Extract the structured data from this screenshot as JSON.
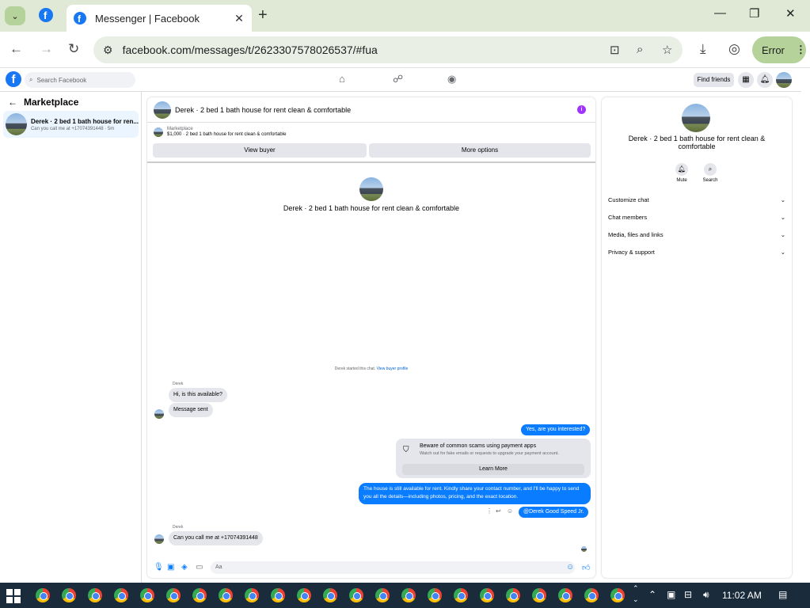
{
  "browser": {
    "tab_title": "Messenger | Facebook",
    "url": "facebook.com/messages/t/2623307578026537/#fua",
    "profile_button": "Error"
  },
  "fb": {
    "search_placeholder": "Search Facebook",
    "find_friends": "Find friends"
  },
  "sidebar": {
    "title": "Marketplace",
    "conversation": {
      "title": "Derek · 2 bed 1 bath house for ren...",
      "preview": "Can you call me at +17074391448 · 5m"
    }
  },
  "chat": {
    "header_title": "Derek · 2 bed 1 bath house for rent clean & comfortable",
    "marketplace_label": "Marketplace",
    "listing_line": "$1,000 · 2 bed 1 bath house for rent clean & comfortable",
    "view_buyer": "View buyer",
    "more_options": "More options",
    "center_name": "Derek · 2 bed 1 bath house for rent clean & comfortable",
    "started_text": "Derek started this chat.",
    "view_buyer_profile": "View buyer profile",
    "sender1": "Derek",
    "msg1": "Hi, is this available?",
    "msg2": "Message sent",
    "out1": "Yes, are you interested?",
    "warning_title": "Beware of common scams using payment apps",
    "warning_sub": "Watch out for fake emails or requests to upgrade your payment account.",
    "learn_more": "Learn More",
    "out2": "The house is still available for rent. Kindly share your contact number, and I'll be happy to send you all the details—including photos, pricing, and the exact location.",
    "mention": "@Derek Good Speed Jr.",
    "sender2": "Derek",
    "msg3": "Can you call me at +17074391448",
    "composer_placeholder": "Aa"
  },
  "details": {
    "name": "Derek · 2 bed 1 bath house for rent clean & comfortable",
    "mute": "Mute",
    "search": "Search",
    "rows": [
      "Customize chat",
      "Chat members",
      "Media, files and links",
      "Privacy & support"
    ]
  },
  "taskbar": {
    "time": "11:02 AM"
  },
  "colors": {
    "accent": "#0a7cff",
    "fb_blue": "#1877f2"
  }
}
